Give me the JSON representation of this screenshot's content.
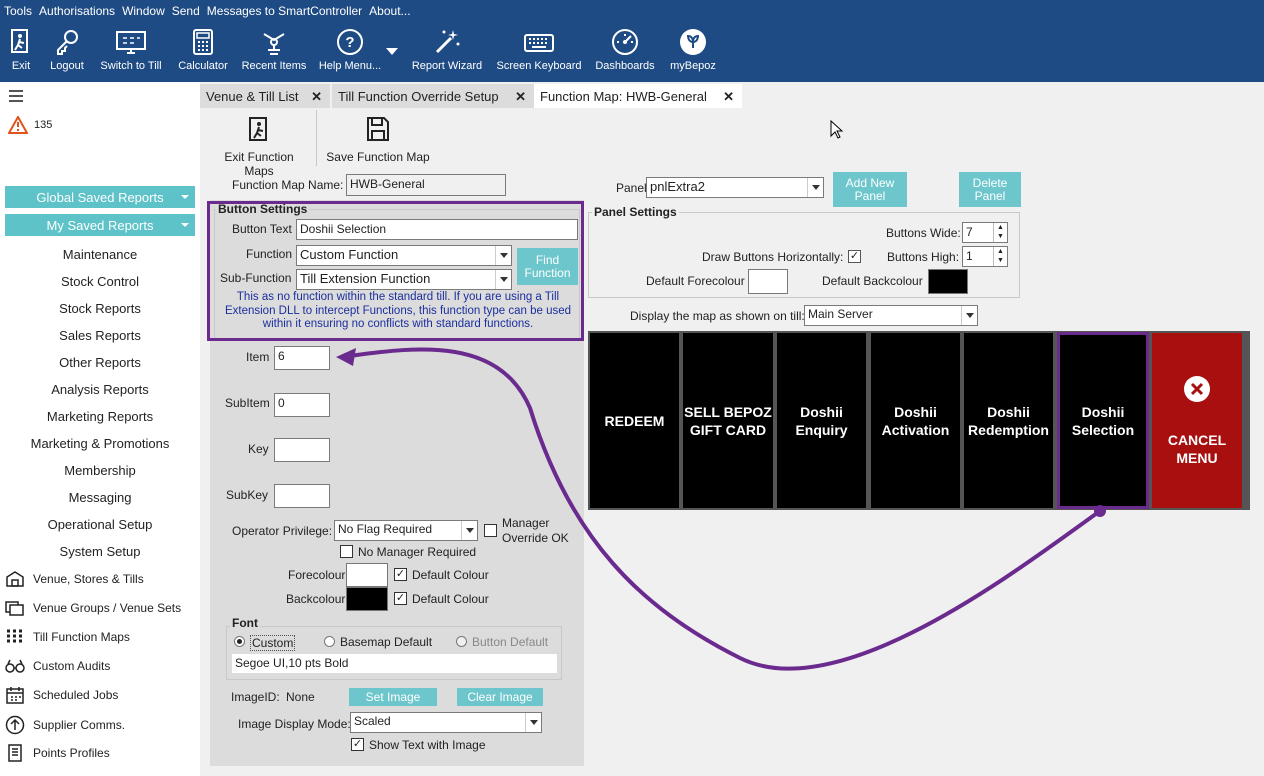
{
  "menu": [
    "Tools",
    "Authorisations",
    "Window",
    "Send",
    "Messages to SmartController",
    "About..."
  ],
  "toolbar": {
    "exit": "Exit",
    "logout": "Logout",
    "switch_to_till": "Switch to Till",
    "calculator": "Calculator",
    "recent_items": "Recent Items",
    "help_menu": "Help Menu...",
    "report_wizard": "Report Wizard",
    "screen_keyboard": "Screen Keyboard",
    "dashboards": "Dashboards",
    "mybepoz": "myBepoz"
  },
  "sidebar": {
    "alert_count": "135",
    "global_saved_reports": "Global Saved Reports",
    "my_saved_reports": "My Saved Reports",
    "items": [
      "Maintenance",
      "Stock Control",
      "Stock Reports",
      "Sales Reports",
      "Other Reports",
      "Analysis Reports",
      "Marketing Reports",
      "Marketing & Promotions",
      "Membership",
      "Messaging",
      "Operational Setup",
      "System Setup"
    ],
    "icon_items": [
      "Venue, Stores & Tills",
      "Venue Groups / Venue Sets",
      "Till Function Maps",
      "Custom Audits",
      "Scheduled Jobs",
      "Supplier Comms.",
      "Points Profiles"
    ]
  },
  "tabs": [
    "Venue & Till List",
    "Till Function Override Setup",
    "Function Map: HWB-General"
  ],
  "actions": {
    "exit_function_maps": "Exit Function Maps",
    "save_function_map": "Save Function Map"
  },
  "form": {
    "function_map_name_label": "Function Map Name:",
    "function_map_name": "HWB-General",
    "button_settings_title": "Button Settings",
    "button_text_label": "Button Text",
    "button_text": "Doshii Selection",
    "function_label": "Function",
    "function_value": "Custom Function",
    "sub_function_label": "Sub-Function",
    "sub_function_value": "Till Extension Function",
    "find_function": "Find Function",
    "help_text": "This as no function within the standard till. If you are using a Till Extension DLL to intercept Functions, this function type can be used within it ensuring no conflicts with standard functions.",
    "item_label": "Item",
    "item_value": "6",
    "subitem_label": "SubItem",
    "subitem_value": "0",
    "key_label": "Key",
    "key_value": "",
    "subkey_label": "SubKey",
    "subkey_value": "",
    "operator_privilege_label": "Operator Privilege:",
    "operator_privilege_value": "No Flag Required",
    "manager_override_label": "Manager Override OK",
    "no_manager_required_label": "No Manager Required",
    "forecolour_label": "Forecolour",
    "backcolour_label": "Backcolour",
    "default_colour_label": "Default Colour",
    "font_title": "Font",
    "font_custom": "Custom",
    "font_basemap_default": "Basemap Default",
    "font_button_default": "Button Default",
    "font_value": "Segoe UI,10 pts Bold",
    "image_id_label": "ImageID:",
    "image_id_value": "None",
    "set_image": "Set Image",
    "clear_image": "Clear Image",
    "image_display_mode_label": "Image Display Mode:",
    "image_display_mode_value": "Scaled",
    "show_text_with_image": "Show Text with Image"
  },
  "panel": {
    "panel_label": "Panel",
    "panel_value": "pnlExtra2",
    "add_new_panel": "Add New Panel",
    "delete_panel": "Delete Panel",
    "panel_settings_title": "Panel Settings",
    "buttons_wide_label": "Buttons Wide:",
    "buttons_wide_value": "7",
    "draw_horizontally_label": "Draw Buttons Horizontally:",
    "buttons_high_label": "Buttons High:",
    "buttons_high_value": "1",
    "default_forecolour_label": "Default Forecolour",
    "default_backcolour_label": "Default Backcolour",
    "display_map_label": "Display the map as shown on till:",
    "display_map_value": "Main Server"
  },
  "till_buttons": [
    "REDEEM",
    "SELL BEPOZ GIFT CARD",
    "Doshii Enquiry",
    "Doshii Activation",
    "Doshii Redemption",
    "Doshii Selection",
    "CANCEL MENU"
  ],
  "colors": {
    "header_bg": "#1f4b84",
    "teal": "#5ec2c9",
    "highlight_purple": "#6a2a8e",
    "cancel_red": "#a81010"
  }
}
